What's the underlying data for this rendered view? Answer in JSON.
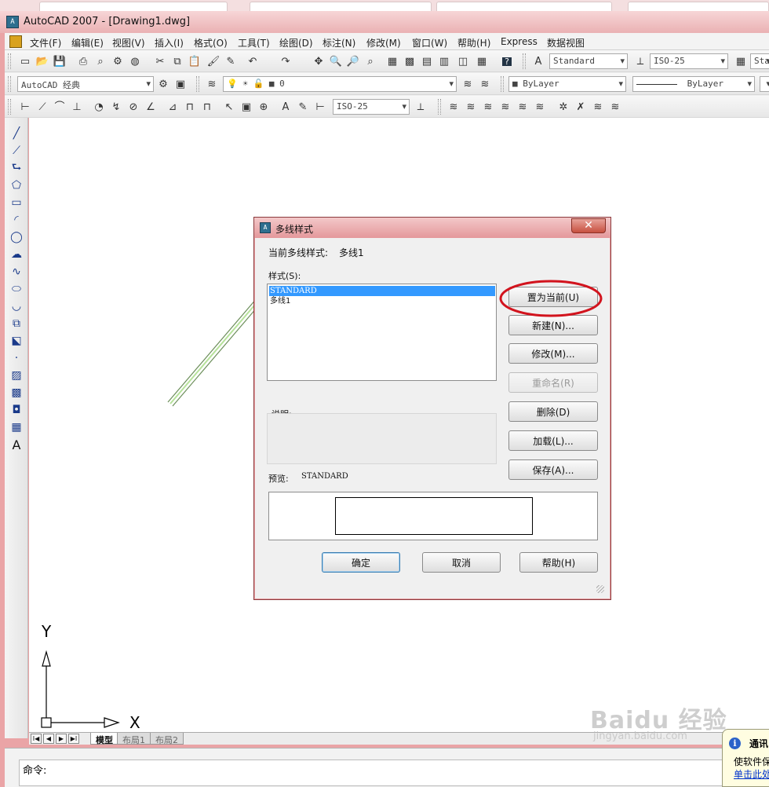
{
  "window": {
    "title": "AutoCAD 2007 - [Drawing1.dwg]",
    "app_icon_glyph": "A"
  },
  "menu": {
    "items": [
      "文件(F)",
      "编辑(E)",
      "视图(V)",
      "插入(I)",
      "格式(O)",
      "工具(T)",
      "绘图(D)",
      "标注(N)",
      "修改(M)",
      "窗口(W)",
      "帮助(H)",
      "Express",
      "数据视图"
    ]
  },
  "toolbar": {
    "text_style": "Standard",
    "dim_style": "ISO-25",
    "table_style": "Sta",
    "workspace": "AutoCAD 经典",
    "layer": "0",
    "color": "ByLayer",
    "linetype": "ByLayer",
    "dim_style_2": "ISO-25"
  },
  "ucs": {
    "x_label": "X",
    "y_label": "Y"
  },
  "layout_tabs": {
    "nav": [
      "I◀",
      "◀",
      "▶",
      "▶I"
    ],
    "model": "模型",
    "layout1": "布局1",
    "layout2": "布局2"
  },
  "command": {
    "prompt": "命令:"
  },
  "notification": {
    "title": "通讯",
    "body": "使软件保",
    "link": "单击此处"
  },
  "watermark": {
    "main": "Baidu 经验",
    "sub": "jingyan.baidu.com"
  },
  "dialog": {
    "title": "多线样式",
    "current_label": "当前多线样式:",
    "current_value": "多线1",
    "styles_label": "样式(S):",
    "styles": [
      "STANDARD",
      "多线1"
    ],
    "selected_index": 0,
    "description_label": "说明:",
    "preview_label": "预览:",
    "preview_value": "STANDARD",
    "buttons": {
      "set_current": "置为当前(U)",
      "new": "新建(N)...",
      "modify": "修改(M)...",
      "rename": "重命名(R)",
      "delete": "删除(D)",
      "load": "加载(L)...",
      "save": "保存(A)...",
      "ok": "确定",
      "cancel": "取消",
      "help": "帮助(H)"
    },
    "close_glyph": "✕"
  },
  "colors": {
    "frame": "#eaa4a6",
    "highlight_circle": "#d2141e",
    "selection": "#3399ff",
    "multiline": "#8bbf6a"
  }
}
